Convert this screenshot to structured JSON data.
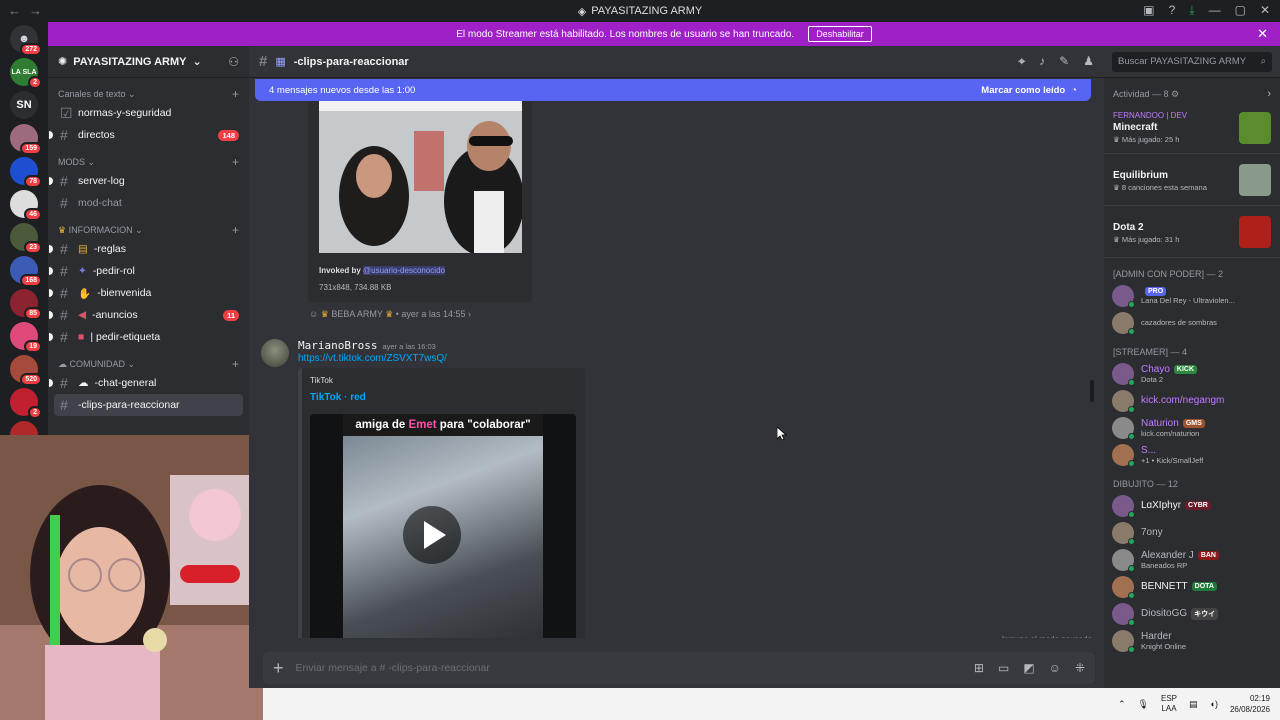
{
  "window": {
    "title": "PAYASITAZING ARMY"
  },
  "banner": {
    "text": "El modo Streamer está habilitado. Los nombres de usuario se han truncado.",
    "button": "Deshabilitar"
  },
  "guilds": {
    "home_badge": "272",
    "items": [
      {
        "label": "LA SLA",
        "color": "#2f7d32",
        "badge": "2"
      },
      {
        "label": "SN",
        "color": "#2b2d31",
        "badge": ""
      },
      {
        "label": "",
        "color": "#9d6b7d",
        "badge": "159"
      },
      {
        "label": "",
        "color": "#1f4fd1",
        "badge": "78"
      },
      {
        "label": "",
        "color": "#dddddd",
        "badge": "46"
      },
      {
        "label": "",
        "color": "#4a5a3a",
        "badge": "23"
      },
      {
        "label": "",
        "color": "#3b5bb5",
        "badge": "168"
      },
      {
        "label": "",
        "color": "#8b2330",
        "badge": "85"
      },
      {
        "label": "",
        "color": "#e04a7a",
        "badge": "19"
      },
      {
        "label": "",
        "color": "#a64a3b",
        "badge": "520"
      },
      {
        "label": "",
        "color": "#c02030",
        "badge": "2"
      },
      {
        "label": "",
        "color": "#b02828",
        "badge": "9"
      }
    ]
  },
  "server": {
    "name": "PAYASITAZING ARMY"
  },
  "channels": {
    "cat1": "Canales de texto",
    "c1": "normas-y-seguridad",
    "c2": "directos",
    "c2_badge": "148",
    "cat2": "MODS",
    "c3": "server-log",
    "c4": "mod-chat",
    "cat3": "INFORMACION",
    "c5": "-reglas",
    "c6": "-pedir-rol",
    "c7": "-bienvenida",
    "c8": "-anuncios",
    "c8_badge": "11",
    "c9": "| pedir-etiqueta",
    "cat4": "COMUNIDAD",
    "c10": "-chat-general",
    "c11": "-clips-para-reaccionar"
  },
  "chat": {
    "channel": "-clips-para-reaccionar",
    "new_messages": "4 mensajes nuevos desde las 1:00",
    "mark_read": "Marcar como leído",
    "invoked_label": "Invoked by",
    "invoked_user": "@usuario-desconocido",
    "img_meta": "731x848, 734.88 KB",
    "reply_user": "BEBA ARMY",
    "reply_time": "ayer a las 14:55",
    "author": "MarianoBross",
    "author_time": "ayer a las 16:03",
    "link": "https://vt.tiktok.com/ZSVXT7wsQ/",
    "embed_provider": "TikTok",
    "embed_title": "TikTok · red",
    "video_caption_a": "amiga de ",
    "video_caption_b": "Emet",
    "video_caption_c": " para \"colaborar\"",
    "immune": "Inmune al modo pausado",
    "composer_placeholder": "Enviar mensaje a # -clips-para-reaccionar"
  },
  "search": {
    "placeholder": "Buscar PAYASITAZING ARMY"
  },
  "members": {
    "activity_head": "Actividad — 8",
    "activities": [
      {
        "user": "FERNANDOO | DEV",
        "game": "Minecraft",
        "sub": "Más jugado: 25 h",
        "color": "#5a8c2e"
      },
      {
        "user": "",
        "game": "Equilibrium",
        "sub": "8 canciones esta semana",
        "color": "#8a9a8a"
      },
      {
        "user": "",
        "game": "Dota 2",
        "sub": "Más jugado: 31 h",
        "color": "#b0201a"
      }
    ],
    "group1": "[ADMIN CON PODER] — 2",
    "g1": [
      {
        "name": "",
        "status": "Lana Del Rey - Ultraviolen...",
        "tag": "PRO",
        "color": "#f2f3f5"
      },
      {
        "name": "",
        "status": "cazadores de sombras",
        "tag": "",
        "color": "#f2f3f5"
      }
    ],
    "group2": "[STREAMER] — 4",
    "g2": [
      {
        "name": "Chayo",
        "status": "Dota 2",
        "tag": "KICK",
        "color": "#c27cff"
      },
      {
        "name": "kick.com/negangm",
        "status": "",
        "tag": "",
        "color": "#c27cff"
      },
      {
        "name": "Naturion",
        "status": "kick.com/naturion",
        "tag": "GMS",
        "color": "#c27cff"
      },
      {
        "name": "S...",
        "status": "+1 • Kick/SmallJeff",
        "tag": "",
        "color": "#c27cff"
      }
    ],
    "group3": "DIBUJITO — 12",
    "g3": [
      {
        "name": "LɑXIphyr",
        "status": "",
        "tag": "CYBR",
        "color": "#f2f3f5"
      },
      {
        "name": "7ony",
        "status": "",
        "tag": "",
        "color": "#b5bac1"
      },
      {
        "name": "Alexander J",
        "status": "Baneados RP",
        "tag": "BAN",
        "color": "#b5bac1"
      },
      {
        "name": "BENNETT",
        "status": "",
        "tag": "DOTA",
        "color": "#f2f3f5"
      },
      {
        "name": "DiositoGG",
        "status": "",
        "tag": "キウイ",
        "color": "#b5bac1"
      },
      {
        "name": "Harder",
        "status": "Knight Online",
        "tag": "",
        "color": "#b5bac1"
      }
    ]
  },
  "taskbar": {
    "lang1": "ESP",
    "lang2": "LAA",
    "time": "02:19",
    "date": "26/08/2026"
  }
}
